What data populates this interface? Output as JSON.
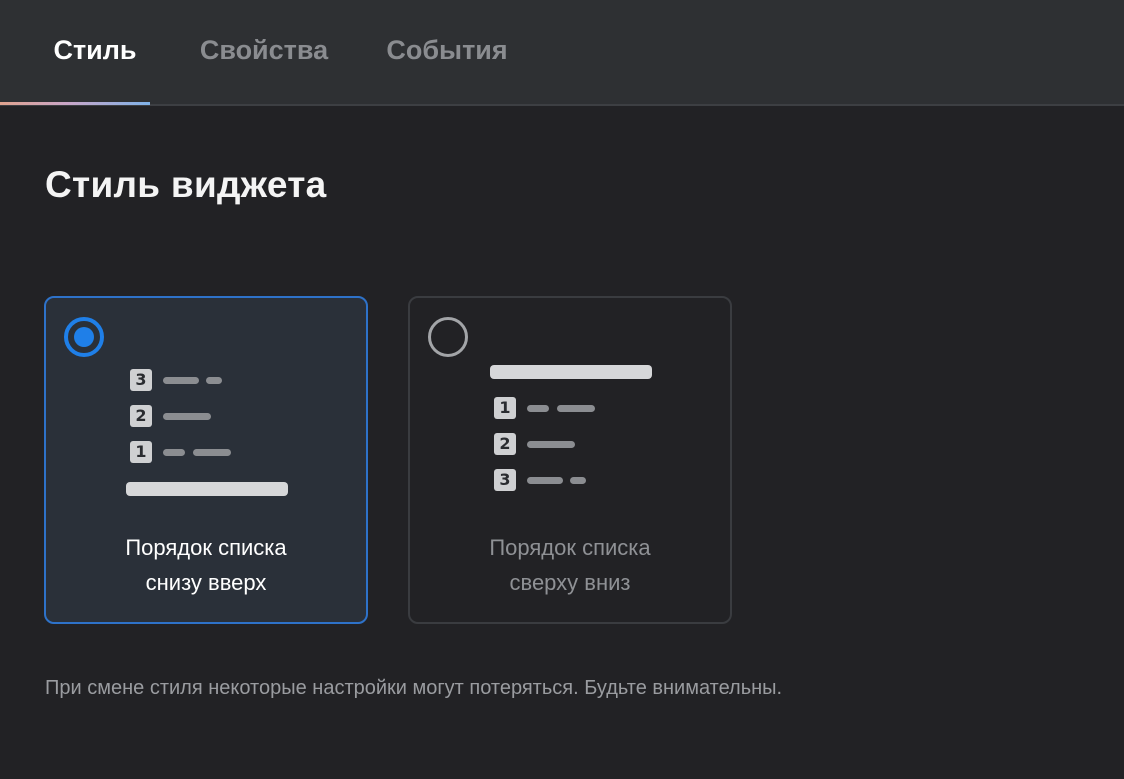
{
  "tabs": [
    {
      "label": "Стиль",
      "active": true
    },
    {
      "label": "Свойства",
      "active": false
    },
    {
      "label": "События",
      "active": false
    }
  ],
  "section_title": "Стиль виджета",
  "options": {
    "bottom_up": {
      "selected": true,
      "label_line1": "Порядок списка",
      "label_line2": "снизу вверх",
      "numbers": [
        "3",
        "2",
        "1"
      ]
    },
    "top_down": {
      "selected": false,
      "label_line1": "Порядок списка",
      "label_line2": "сверху вниз",
      "numbers": [
        "1",
        "2",
        "3"
      ]
    }
  },
  "note": "При смене стиля некоторые настройки могут потеряться. Будьте внимательны.",
  "colors": {
    "accent": "#1f7fe8",
    "background": "#222225",
    "tabbar": "#2e3033"
  }
}
